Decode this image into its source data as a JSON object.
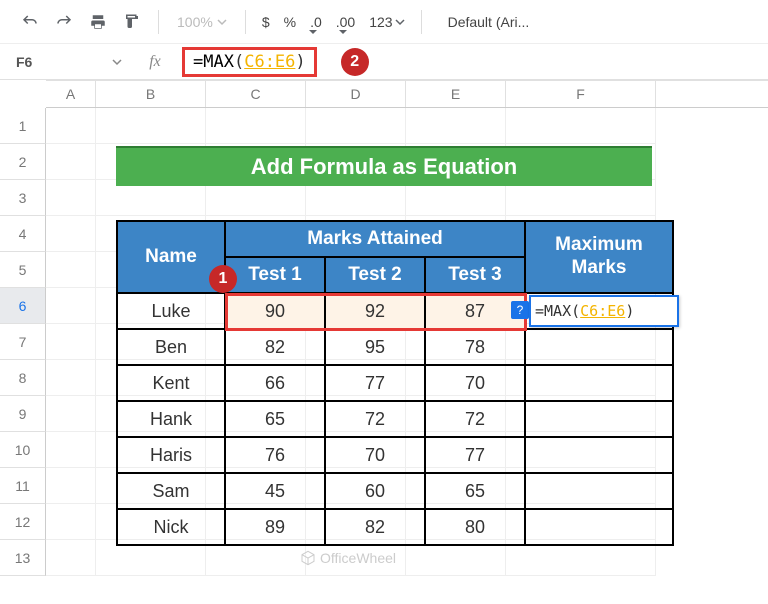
{
  "toolbar": {
    "zoom": "100%",
    "currency": "$",
    "percent": "%",
    "dec_dec": ".0",
    "dec_inc": ".00",
    "num_format": "123",
    "font": "Default (Ari..."
  },
  "namebox": "F6",
  "formula_bar": {
    "prefix": "=",
    "fn": "MAX",
    "open": "(",
    "range": "C6:E6",
    "close": ")"
  },
  "badges": {
    "one": "1",
    "two": "2"
  },
  "columns": [
    "A",
    "B",
    "C",
    "D",
    "E",
    "F"
  ],
  "rows": [
    "1",
    "2",
    "3",
    "4",
    "5",
    "6",
    "7",
    "8",
    "9",
    "10",
    "11",
    "12",
    "13"
  ],
  "title": "Add Formula as Equation",
  "headers": {
    "name": "Name",
    "marks": "Marks Attained",
    "max": "Maximum Marks",
    "tests": [
      "Test 1",
      "Test 2",
      "Test 3"
    ]
  },
  "data": [
    {
      "name": "Luke",
      "t1": "90",
      "t2": "92",
      "t3": "87"
    },
    {
      "name": "Ben",
      "t1": "82",
      "t2": "95",
      "t3": "78"
    },
    {
      "name": "Kent",
      "t1": "66",
      "t2": "77",
      "t3": "70"
    },
    {
      "name": "Hank",
      "t1": "65",
      "t2": "72",
      "t3": "72"
    },
    {
      "name": "Haris",
      "t1": "76",
      "t2": "70",
      "t3": "77"
    },
    {
      "name": "Sam",
      "t1": "45",
      "t2": "60",
      "t3": "65"
    },
    {
      "name": "Nick",
      "t1": "89",
      "t2": "82",
      "t3": "80"
    }
  ],
  "inline_formula": {
    "prefix": "=MAX(",
    "range": "C6:E6",
    "suffix": ")"
  },
  "help_icon": "?",
  "watermark": "OfficeWheel",
  "chart_data": {
    "type": "table",
    "title": "Add Formula as Equation",
    "columns": [
      "Name",
      "Test 1",
      "Test 2",
      "Test 3"
    ],
    "rows": [
      [
        "Luke",
        90,
        92,
        87
      ],
      [
        "Ben",
        82,
        95,
        78
      ],
      [
        "Kent",
        66,
        77,
        70
      ],
      [
        "Hank",
        65,
        72,
        72
      ],
      [
        "Haris",
        76,
        70,
        77
      ],
      [
        "Sam",
        45,
        60,
        65
      ],
      [
        "Nick",
        89,
        82,
        80
      ]
    ]
  }
}
